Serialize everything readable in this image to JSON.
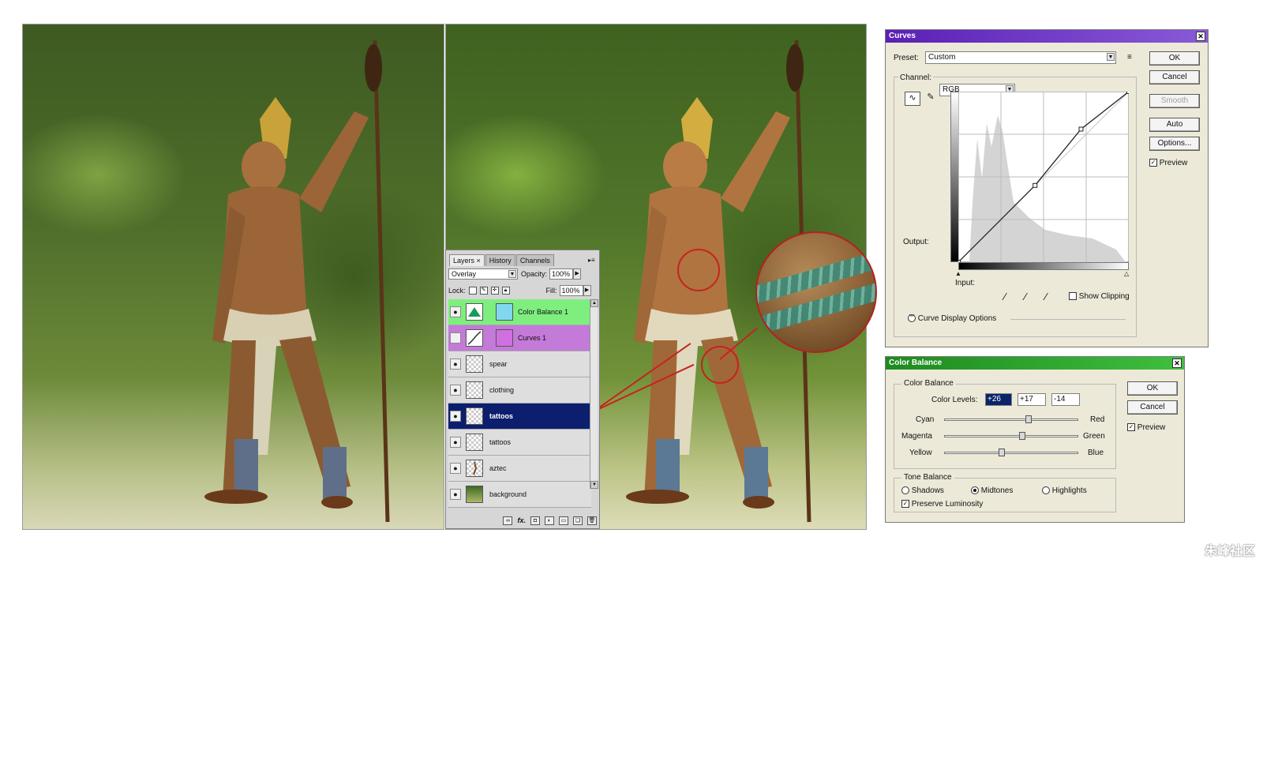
{
  "artwork": {
    "before_name": "painting-before",
    "after_name": "painting-after"
  },
  "layers_panel": {
    "tabs": [
      "Layers",
      "History",
      "Channels"
    ],
    "tab_close": "×",
    "blend_mode": "Overlay",
    "opacity_label": "Opacity:",
    "opacity_value": "100%",
    "lock_label": "Lock:",
    "fill_label": "Fill:",
    "fill_value": "100%",
    "layers": [
      {
        "name": "Color Balance 1",
        "visible": true,
        "type": "adjustment",
        "color": "#7eef7e",
        "swatch": "#7fd8f0"
      },
      {
        "name": "Curves 1",
        "visible": false,
        "type": "adjustment",
        "color": "#c47ad8",
        "swatch": "#d070e0"
      },
      {
        "name": "spear",
        "visible": true,
        "type": "layer",
        "color": "#dedede"
      },
      {
        "name": "clothing",
        "visible": true,
        "type": "layer",
        "color": "#dedede"
      },
      {
        "name": "tattoos",
        "visible": true,
        "type": "layer",
        "color": "#0c1f6e",
        "selected": true
      },
      {
        "name": "tattoos",
        "visible": true,
        "type": "layer",
        "color": "#dedede"
      },
      {
        "name": "aztec",
        "visible": true,
        "type": "layer",
        "color": "#dedede"
      },
      {
        "name": "background",
        "visible": true,
        "type": "layer",
        "color": "#dedede"
      }
    ],
    "footer_icons": [
      "link-icon",
      "fx-icon",
      "mask-icon",
      "adjustment-icon",
      "group-icon",
      "new-layer-icon",
      "trash-icon"
    ],
    "footer_fx": "fx."
  },
  "curves": {
    "title": "Curves",
    "title_color": "#5a1fb5",
    "preset_label": "Preset:",
    "preset_value": "Custom",
    "channel_label": "Channel:",
    "channel_value": "RGB",
    "output_label": "Output:",
    "input_label": "Input:",
    "show_clipping_label": "Show Clipping",
    "display_options_label": "Curve Display Options",
    "buttons": {
      "ok": "OK",
      "cancel": "Cancel",
      "smooth": "Smooth",
      "auto": "Auto",
      "options": "Options..."
    },
    "preview_label": "Preview",
    "preview_checked": true,
    "curve_points": [
      [
        0,
        0
      ],
      [
        45,
        45
      ],
      [
        72,
        78
      ],
      [
        100,
        100
      ]
    ]
  },
  "color_balance": {
    "title": "Color Balance",
    "title_color": "#1e8a1e",
    "group_label": "Color Balance",
    "levels_label": "Color Levels:",
    "levels": [
      "+26",
      "+17",
      "-14"
    ],
    "sliders": [
      {
        "left": "Cyan",
        "right": "Red",
        "value": 26
      },
      {
        "left": "Magenta",
        "right": "Green",
        "value": 17
      },
      {
        "left": "Yellow",
        "right": "Blue",
        "value": -14
      }
    ],
    "tone_label": "Tone Balance",
    "tones": [
      "Shadows",
      "Midtones",
      "Highlights"
    ],
    "tone_selected": "Midtones",
    "preserve_label": "Preserve Luminosity",
    "preserve_checked": true,
    "buttons": {
      "ok": "OK",
      "cancel": "Cancel"
    },
    "preview_label": "Preview",
    "preview_checked": true
  },
  "watermark": "朱峰社区"
}
